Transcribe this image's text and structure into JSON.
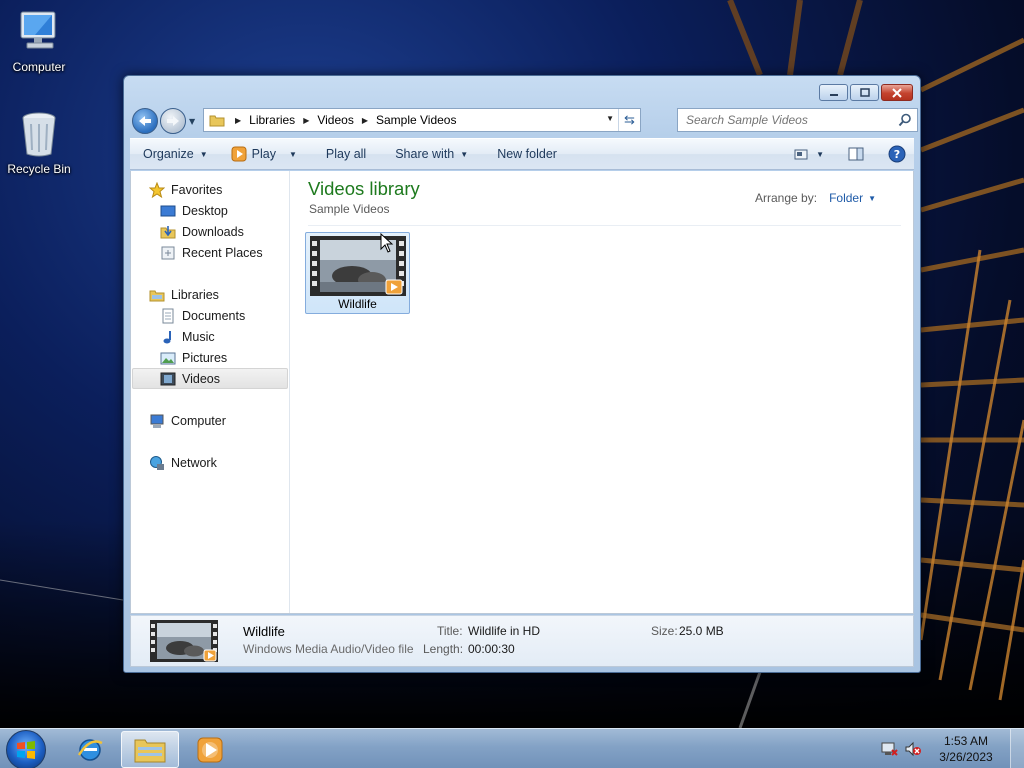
{
  "desktop": {
    "icons": [
      {
        "label": "Computer",
        "icon": "computer-icon"
      },
      {
        "label": "Recycle Bin",
        "icon": "recycle-bin-icon"
      }
    ]
  },
  "window": {
    "caption_buttons": [
      "minimize",
      "restore",
      "close"
    ],
    "address": {
      "crumbs": [
        "Libraries",
        "Videos",
        "Sample Videos"
      ]
    },
    "search": {
      "placeholder": "Search Sample Videos"
    },
    "toolbar": {
      "organize": "Organize",
      "play": "Play",
      "play_all": "Play all",
      "share_with": "Share with",
      "new_folder": "New folder"
    },
    "navpane": {
      "favorites": {
        "label": "Favorites",
        "items": [
          "Desktop",
          "Downloads",
          "Recent Places"
        ]
      },
      "libraries": {
        "label": "Libraries",
        "items": [
          "Documents",
          "Music",
          "Pictures",
          "Videos"
        ]
      },
      "computer": "Computer",
      "network": "Network",
      "selected": "Videos"
    },
    "content": {
      "title": "Videos library",
      "subtitle": "Sample Videos",
      "arrange_label": "Arrange by:",
      "arrange_value": "Folder",
      "items": [
        {
          "name": "Wildlife"
        }
      ]
    },
    "details": {
      "name": "Wildlife",
      "type": "Windows Media Audio/Video file",
      "title_label": "Title:",
      "title_value": "Wildlife in HD",
      "length_label": "Length:",
      "length_value": "00:00:30",
      "size_label": "Size:",
      "size_value": "25.0 MB"
    }
  },
  "taskbar": {
    "pinned": [
      "internet-explorer-icon",
      "windows-explorer-icon",
      "windows-media-player-icon"
    ],
    "active": "windows-explorer-icon",
    "clock": {
      "time": "1:53 AM",
      "date": "3/26/2023"
    }
  },
  "colors": {
    "library_title": "#1e7a1e",
    "link_blue": "#1f5ba8",
    "selection_blue": "#cfe5f9"
  }
}
